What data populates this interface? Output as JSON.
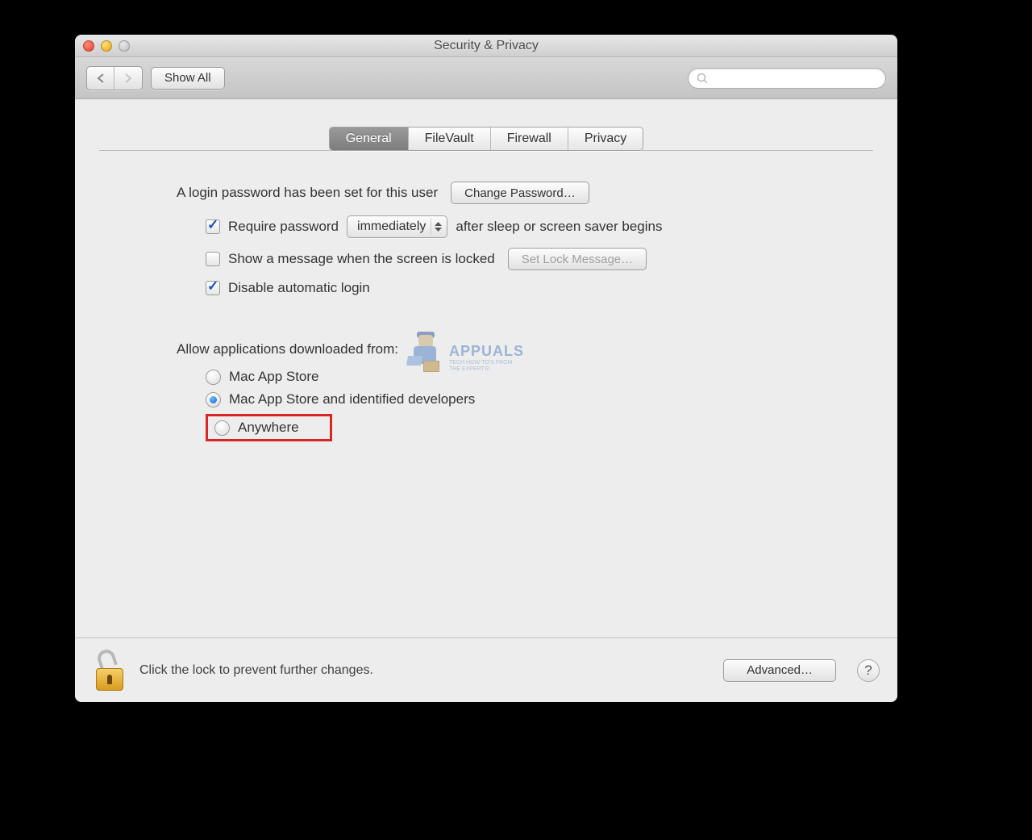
{
  "window": {
    "title": "Security & Privacy"
  },
  "toolbar": {
    "show_all_label": "Show All",
    "search_placeholder": ""
  },
  "tabs": {
    "general": "General",
    "filevault": "FileVault",
    "firewall": "Firewall",
    "privacy": "Privacy"
  },
  "general": {
    "login_pw_set": "A login password has been set for this user",
    "change_password_btn": "Change Password…",
    "require_password_label": "Require password",
    "require_password_popup": "immediately",
    "after_sleep_label": "after sleep or screen saver begins",
    "show_message_label": "Show a message when the screen is locked",
    "set_lock_message_btn": "Set Lock Message…",
    "disable_auto_login_label": "Disable automatic login",
    "allow_apps_label": "Allow applications downloaded from:",
    "radio_app_store": "Mac App Store",
    "radio_identified": "Mac App Store and identified developers",
    "radio_anywhere": "Anywhere"
  },
  "footer": {
    "lock_text": "Click the lock to prevent further changes.",
    "advanced_btn": "Advanced…",
    "help": "?"
  },
  "watermark": {
    "brand": "APPUALS",
    "tag1": "TECH HOW-TO'S FROM",
    "tag2": "THE EXPERTS!"
  }
}
